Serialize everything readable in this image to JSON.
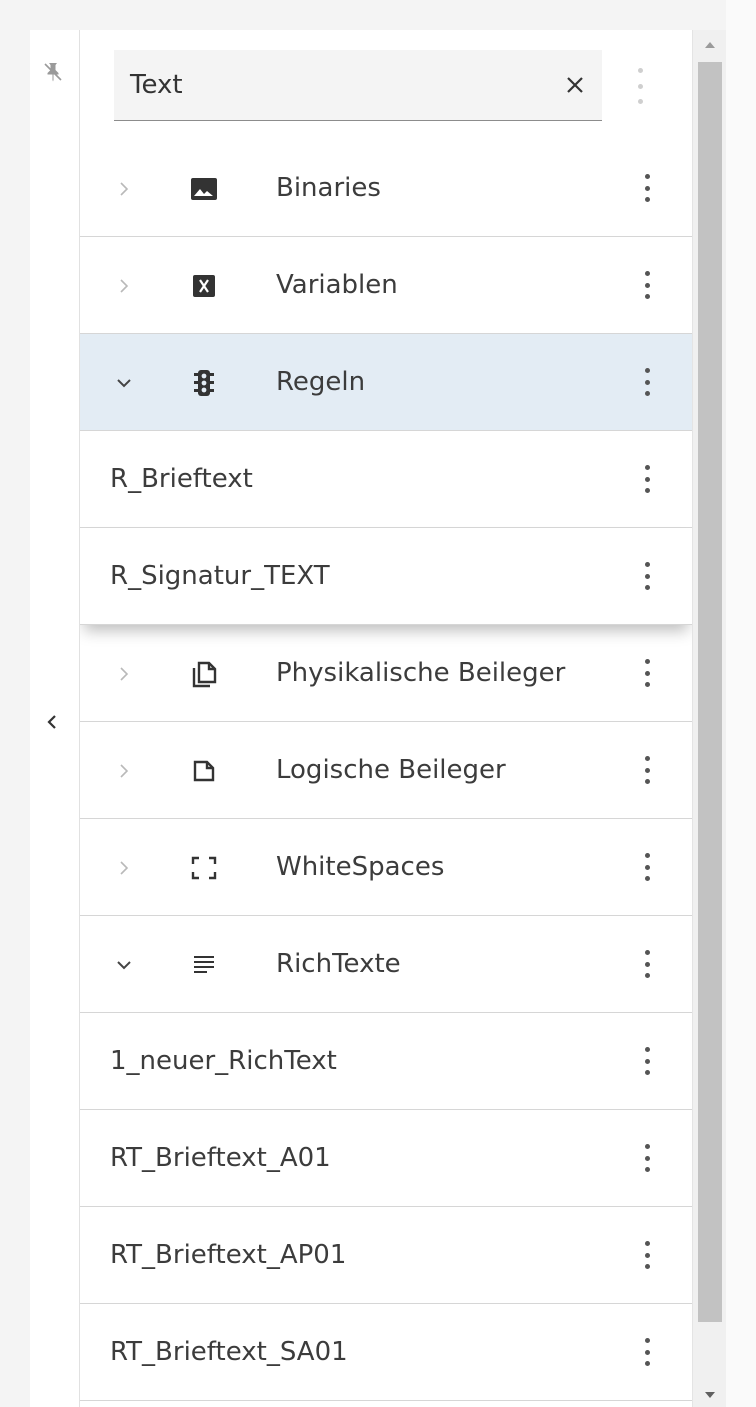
{
  "search": {
    "value": "Text",
    "clear_icon": "close-icon"
  },
  "tree": {
    "items": [
      {
        "label": "Binaries",
        "icon": "image-icon",
        "expanded": false
      },
      {
        "label": "Variablen",
        "icon": "variable-icon",
        "expanded": false
      },
      {
        "label": "Regeln",
        "icon": "traffic-light-icon",
        "expanded": true,
        "selected": true,
        "children": [
          "R_Brieftext",
          "R_Signatur_TEXT"
        ]
      },
      {
        "label": "Physikalische Beileger",
        "icon": "copy-document-icon",
        "expanded": false
      },
      {
        "label": "Logische Beileger",
        "icon": "document-icon",
        "expanded": false
      },
      {
        "label": "WhiteSpaces",
        "icon": "frame-corners-icon",
        "expanded": false
      },
      {
        "label": "RichTexte",
        "icon": "text-lines-icon",
        "expanded": true,
        "children": [
          "1_neuer_RichText",
          "RT_Brieftext_A01",
          "RT_Brieftext_AP01",
          "RT_Brieftext_SA01"
        ]
      }
    ]
  },
  "colors": {
    "selected_row": "#e3ecf4",
    "divider": "#d6d6d6",
    "scroll_thumb": "#c2c2c2"
  }
}
